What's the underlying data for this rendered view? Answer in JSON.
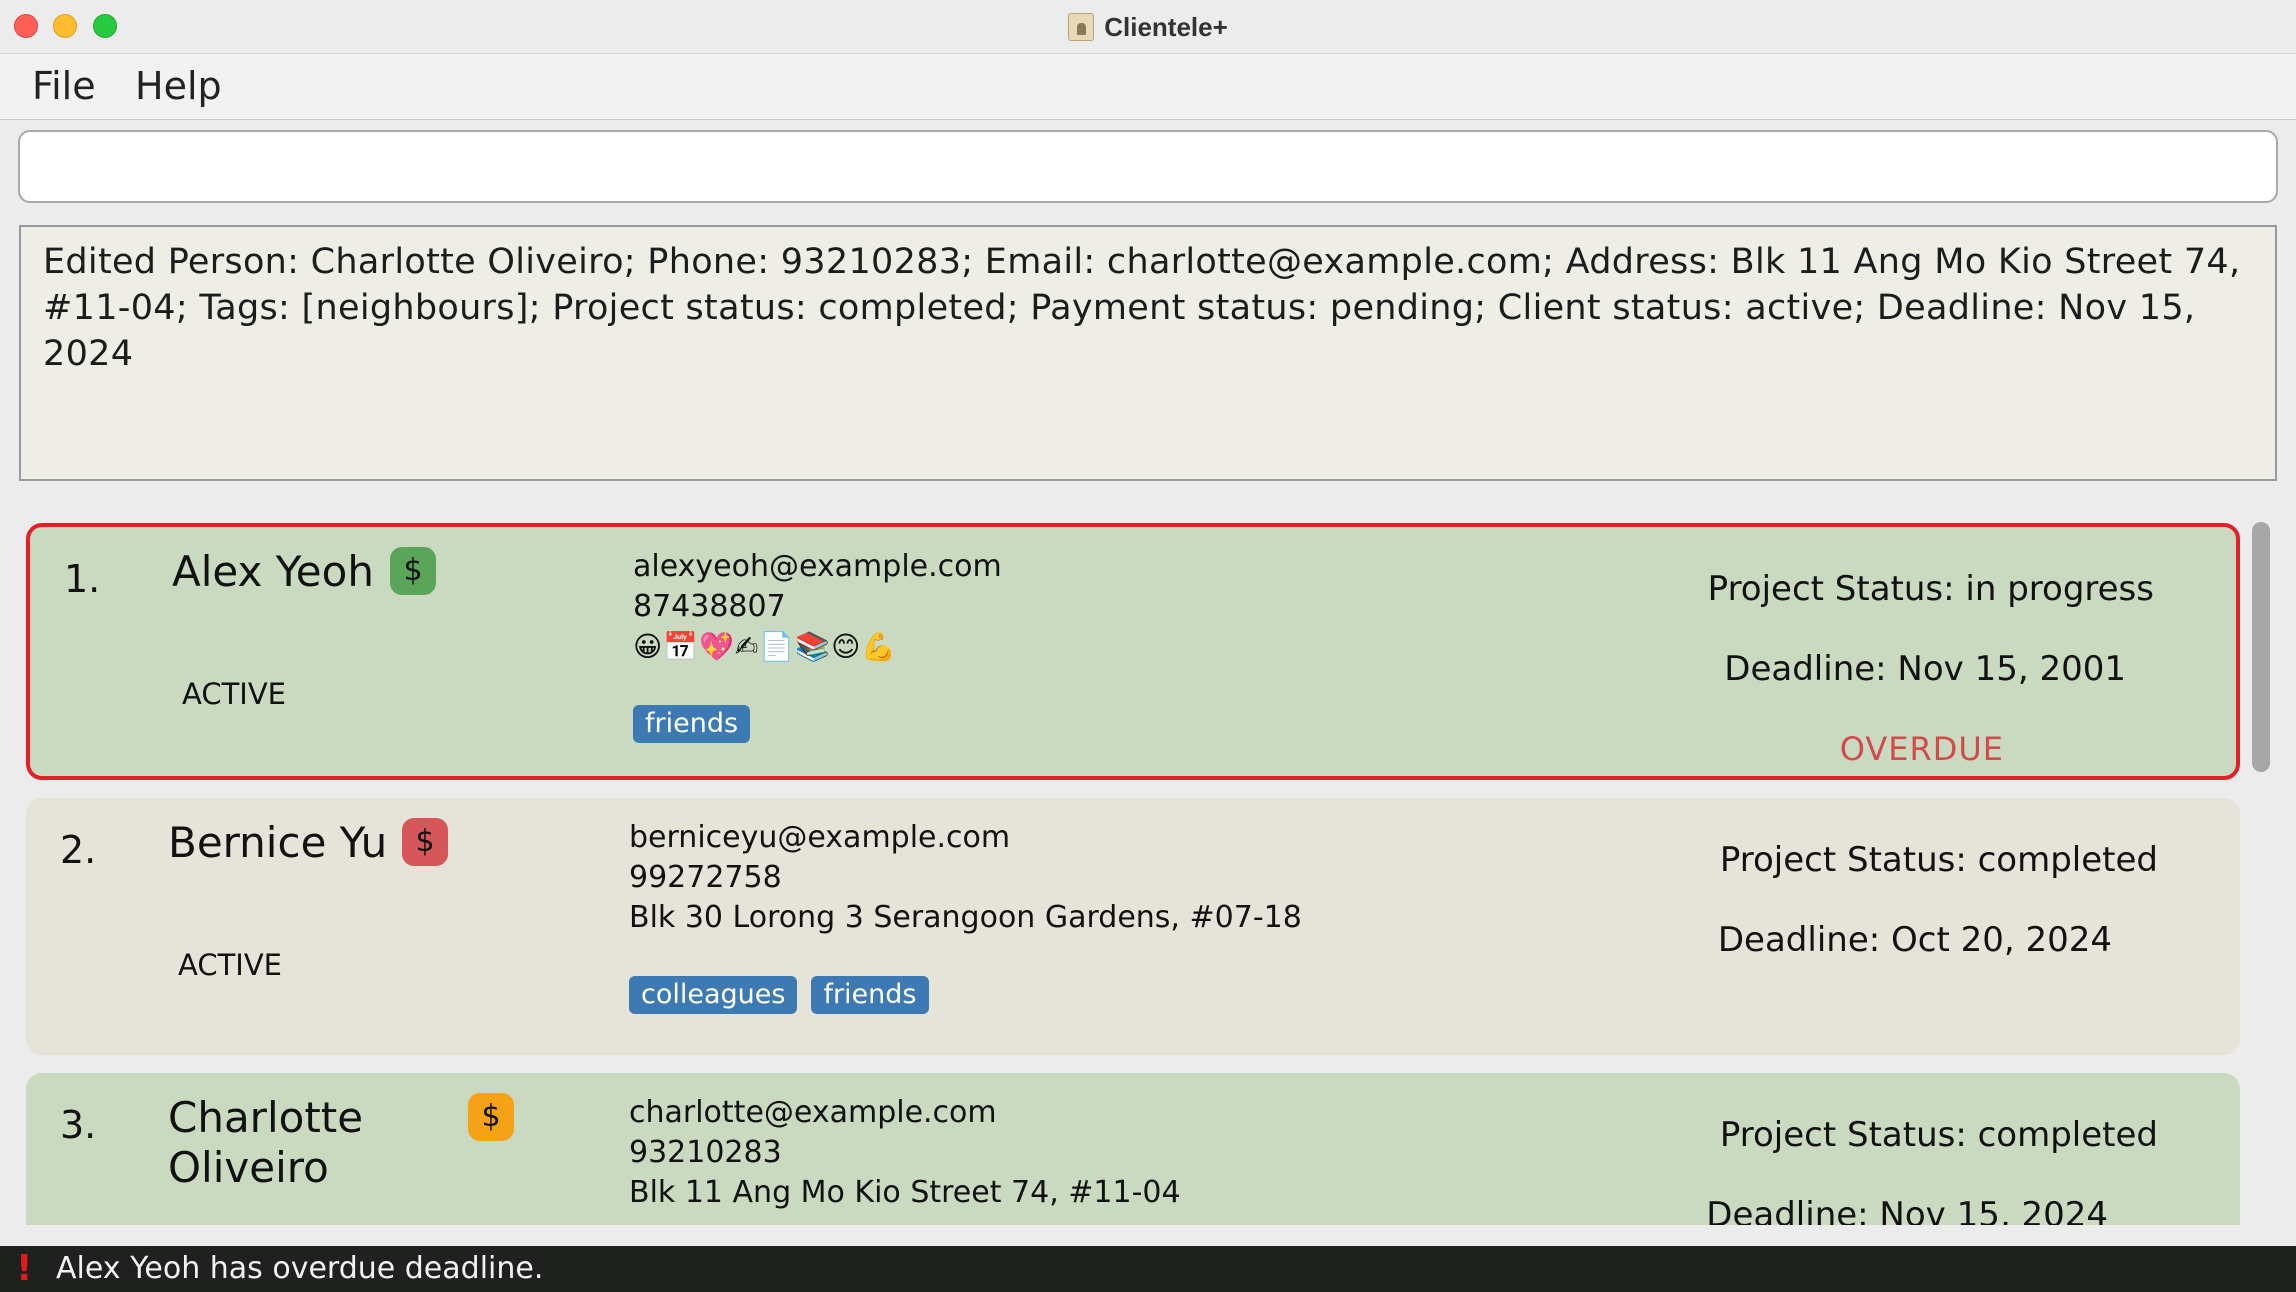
{
  "window": {
    "title": "Clientele+"
  },
  "menu": {
    "file": "File",
    "help": "Help"
  },
  "command": {
    "value": ""
  },
  "result": {
    "text": "Edited Person: Charlotte Oliveiro; Phone: 93210283; Email: charlotte@example.com; Address: Blk 11 Ang Mo Kio Street 74, #11-04; Tags: [neighbours]; Project status: completed; Payment status: pending; Client status: active; Deadline: Nov 15, 2024"
  },
  "persons": [
    {
      "index": "1.",
      "name": "Alex Yeoh",
      "payment_icon": "$",
      "payment_color": "#5aa55a",
      "client_status": "ACTIVE",
      "email": "alexyeoh@example.com",
      "phone": "87438807",
      "address": "😀📅💖✍📄📚😊💪",
      "tags": [
        "friends"
      ],
      "project_status": "Project Status: in progress",
      "deadline": "Deadline: Nov 15, 2001",
      "overdue": "OVERDUE"
    },
    {
      "index": "2.",
      "name": "Bernice Yu",
      "payment_icon": "$",
      "payment_color": "#d5575a",
      "client_status": "ACTIVE",
      "email": "berniceyu@example.com",
      "phone": "99272758",
      "address": "Blk 30 Lorong 3 Serangoon Gardens, #07-18",
      "tags": [
        "colleagues",
        "friends"
      ],
      "project_status": "Project Status: completed",
      "deadline": "Deadline: Oct 20, 2024"
    },
    {
      "index": "3.",
      "name": "Charlotte Oliveiro",
      "payment_icon": "$",
      "payment_color": "#f5a216",
      "email": "charlotte@example.com",
      "phone": "93210283",
      "address": "Blk 11 Ang Mo Kio Street 74, #11-04",
      "project_status": "Project Status: completed",
      "deadline": "Deadline: Nov 15, 2024"
    }
  ],
  "status_bar": {
    "icon": "!",
    "message": "Alex Yeoh has overdue deadline."
  }
}
